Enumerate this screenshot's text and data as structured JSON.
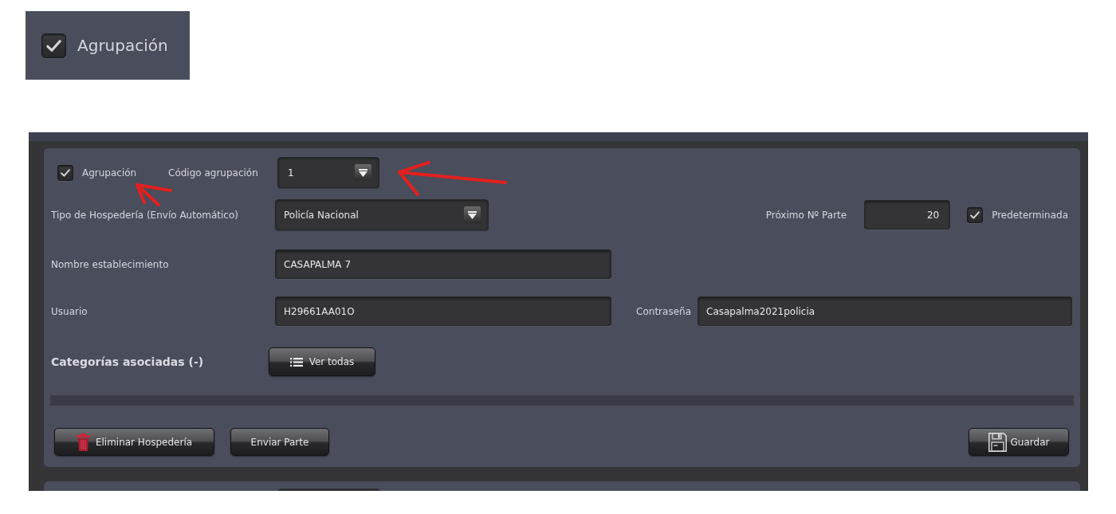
{
  "zoom_inset": {
    "label": "Agrupación",
    "checked": true
  },
  "form": {
    "agrupacion": {
      "label": "Agrupación",
      "checked": true
    },
    "codigo_agrupacion": {
      "label": "Código agrupación",
      "value": "1"
    },
    "tipo_hospederia": {
      "label": "Tipo de Hospedería (Envío Automático)",
      "value": "Policía Nacional"
    },
    "proximo_parte": {
      "label": "Próximo Nº Parte",
      "value": "20"
    },
    "predeterminada": {
      "label": "Predeterminada",
      "checked": true
    },
    "nombre_establecimiento": {
      "label": "Nombre establecimiento",
      "value": "CASAPALMA 7"
    },
    "usuario": {
      "label": "Usuario",
      "value": "H29661AA01O"
    },
    "contrasena": {
      "label": "Contraseña",
      "value": "Casapalma2021policia"
    },
    "categorias": {
      "title": "Categorías asociadas (-)",
      "button": "Ver todas"
    },
    "delete_button": "Eliminar Hospedería",
    "send_button": "Enviar Parte",
    "save_button": "Guardar"
  }
}
